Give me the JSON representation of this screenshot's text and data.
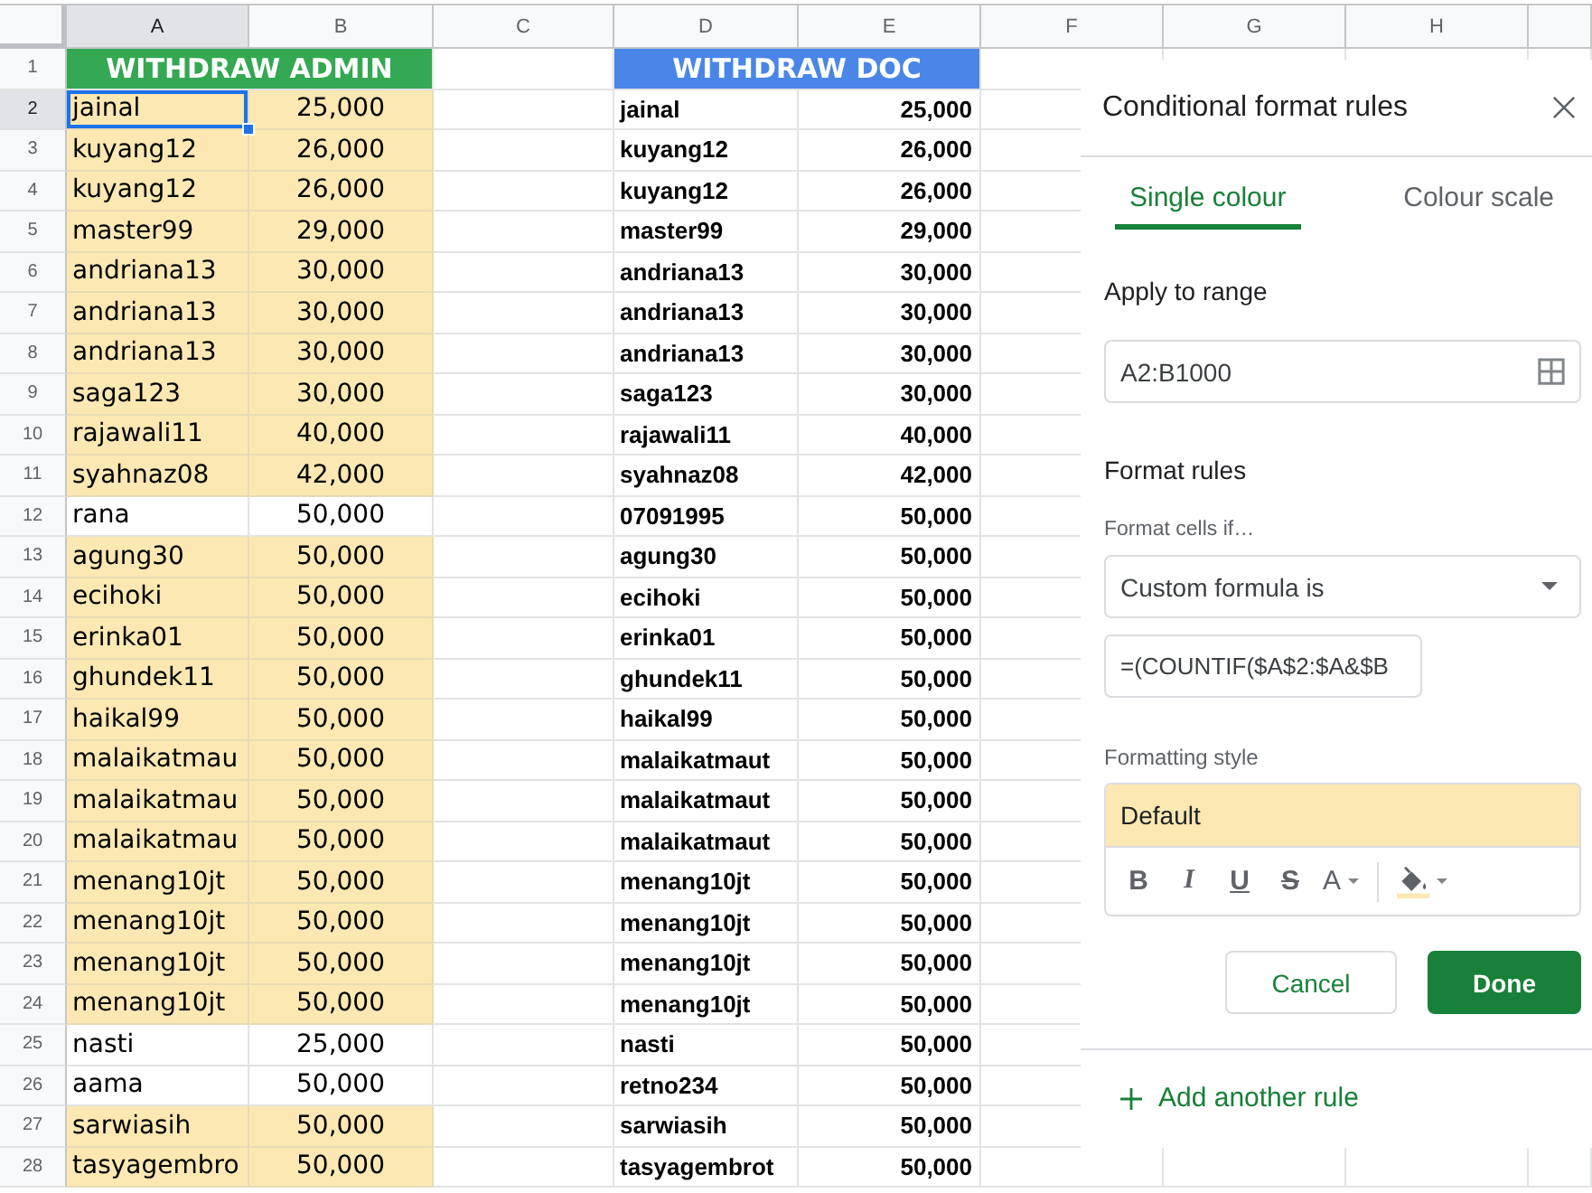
{
  "sheet": {
    "columns": [
      {
        "label": "A",
        "selected": true
      },
      {
        "label": "B",
        "selected": false
      },
      {
        "label": "C",
        "selected": false
      },
      {
        "label": "D",
        "selected": false
      },
      {
        "label": "E",
        "selected": false
      },
      {
        "label": "F",
        "selected": false
      },
      {
        "label": "G",
        "selected": false
      },
      {
        "label": "H",
        "selected": false
      }
    ],
    "row_headers": [
      {
        "label": "1",
        "selected": false
      },
      {
        "label": "2",
        "selected": true
      },
      {
        "label": "3",
        "selected": false
      },
      {
        "label": "4",
        "selected": false
      },
      {
        "label": "5",
        "selected": false
      },
      {
        "label": "6",
        "selected": false
      },
      {
        "label": "7",
        "selected": false
      },
      {
        "label": "8",
        "selected": false
      },
      {
        "label": "9",
        "selected": false
      },
      {
        "label": "10",
        "selected": false
      },
      {
        "label": "11",
        "selected": false
      },
      {
        "label": "12",
        "selected": false
      },
      {
        "label": "13",
        "selected": false
      },
      {
        "label": "14",
        "selected": false
      },
      {
        "label": "15",
        "selected": false
      },
      {
        "label": "16",
        "selected": false
      },
      {
        "label": "17",
        "selected": false
      },
      {
        "label": "18",
        "selected": false
      },
      {
        "label": "19",
        "selected": false
      },
      {
        "label": "20",
        "selected": false
      },
      {
        "label": "21",
        "selected": false
      },
      {
        "label": "22",
        "selected": false
      },
      {
        "label": "23",
        "selected": false
      },
      {
        "label": "24",
        "selected": false
      },
      {
        "label": "25",
        "selected": false
      },
      {
        "label": "26",
        "selected": false
      },
      {
        "label": "27",
        "selected": false
      },
      {
        "label": "28",
        "selected": false
      }
    ],
    "admin_table": {
      "title": "WITHDRAW ADMIN",
      "rows": [
        {
          "name": "jainal",
          "amount": "25,000",
          "highlighted": true,
          "selected": true
        },
        {
          "name": "kuyang12",
          "amount": "26,000",
          "highlighted": true,
          "selected": false
        },
        {
          "name": "kuyang12",
          "amount": "26,000",
          "highlighted": true,
          "selected": false
        },
        {
          "name": "master99",
          "amount": "29,000",
          "highlighted": true,
          "selected": false
        },
        {
          "name": "andriana13",
          "amount": "30,000",
          "highlighted": true,
          "selected": false
        },
        {
          "name": "andriana13",
          "amount": "30,000",
          "highlighted": true,
          "selected": false
        },
        {
          "name": "andriana13",
          "amount": "30,000",
          "highlighted": true,
          "selected": false
        },
        {
          "name": "saga123",
          "amount": "30,000",
          "highlighted": true,
          "selected": false
        },
        {
          "name": "rajawali11",
          "amount": "40,000",
          "highlighted": true,
          "selected": false
        },
        {
          "name": "syahnaz08",
          "amount": "42,000",
          "highlighted": true,
          "selected": false
        },
        {
          "name": "rana",
          "amount": "50,000",
          "highlighted": false,
          "selected": false
        },
        {
          "name": "agung30",
          "amount": "50,000",
          "highlighted": true,
          "selected": false
        },
        {
          "name": "ecihoki",
          "amount": "50,000",
          "highlighted": true,
          "selected": false
        },
        {
          "name": "erinka01",
          "amount": "50,000",
          "highlighted": true,
          "selected": false
        },
        {
          "name": "ghundek11",
          "amount": "50,000",
          "highlighted": true,
          "selected": false
        },
        {
          "name": "haikal99",
          "amount": "50,000",
          "highlighted": true,
          "selected": false
        },
        {
          "name": "malaikatmau",
          "amount": "50,000",
          "highlighted": true,
          "selected": false
        },
        {
          "name": "malaikatmau",
          "amount": "50,000",
          "highlighted": true,
          "selected": false
        },
        {
          "name": "malaikatmau",
          "amount": "50,000",
          "highlighted": true,
          "selected": false
        },
        {
          "name": "menang10jt",
          "amount": "50,000",
          "highlighted": true,
          "selected": false
        },
        {
          "name": "menang10jt",
          "amount": "50,000",
          "highlighted": true,
          "selected": false
        },
        {
          "name": "menang10jt",
          "amount": "50,000",
          "highlighted": true,
          "selected": false
        },
        {
          "name": "menang10jt",
          "amount": "50,000",
          "highlighted": true,
          "selected": false
        },
        {
          "name": "nasti",
          "amount": "25,000",
          "highlighted": false,
          "selected": false
        },
        {
          "name": "aama",
          "amount": "50,000",
          "highlighted": false,
          "selected": false
        },
        {
          "name": "sarwiasih",
          "amount": "50,000",
          "highlighted": true,
          "selected": false
        },
        {
          "name": "tasyagembro",
          "amount": "50,000",
          "highlighted": true,
          "selected": false
        }
      ]
    },
    "doc_table": {
      "title": "WITHDRAW DOC",
      "rows": [
        {
          "name": "jainal",
          "amount": "25,000"
        },
        {
          "name": "kuyang12",
          "amount": "26,000"
        },
        {
          "name": "kuyang12",
          "amount": "26,000"
        },
        {
          "name": "master99",
          "amount": "29,000"
        },
        {
          "name": "andriana13",
          "amount": "30,000"
        },
        {
          "name": "andriana13",
          "amount": "30,000"
        },
        {
          "name": "andriana13",
          "amount": "30,000"
        },
        {
          "name": "saga123",
          "amount": "30,000"
        },
        {
          "name": "rajawali11",
          "amount": "40,000"
        },
        {
          "name": "syahnaz08",
          "amount": "42,000"
        },
        {
          "name": "07091995",
          "amount": "50,000"
        },
        {
          "name": "agung30",
          "amount": "50,000"
        },
        {
          "name": "ecihoki",
          "amount": "50,000"
        },
        {
          "name": "erinka01",
          "amount": "50,000"
        },
        {
          "name": "ghundek11",
          "amount": "50,000"
        },
        {
          "name": "haikal99",
          "amount": "50,000"
        },
        {
          "name": "malaikatmaut",
          "amount": "50,000"
        },
        {
          "name": "malaikatmaut",
          "amount": "50,000"
        },
        {
          "name": "malaikatmaut",
          "amount": "50,000"
        },
        {
          "name": "menang10jt",
          "amount": "50,000"
        },
        {
          "name": "menang10jt",
          "amount": "50,000"
        },
        {
          "name": "menang10jt",
          "amount": "50,000"
        },
        {
          "name": "menang10jt",
          "amount": "50,000"
        },
        {
          "name": "nasti",
          "amount": "50,000"
        },
        {
          "name": "retno234",
          "amount": "50,000"
        },
        {
          "name": "sarwiasih",
          "amount": "50,000"
        },
        {
          "name": "tasyagembrot",
          "amount": "50,000"
        }
      ]
    }
  },
  "panel": {
    "title": "Conditional format rules",
    "tabs": [
      {
        "label": "Single colour",
        "selected": true
      },
      {
        "label": "Colour scale",
        "selected": false
      }
    ],
    "range_label": "Apply to range",
    "range_value": "A2:B1000",
    "rules_heading": "Format rules",
    "condition_label": "Format cells if…",
    "condition_value": "Custom formula is",
    "formula_value": "=(COUNTIF($A$2:$A&$B",
    "style_label": "Formatting style",
    "style_preview": "Default",
    "style_tools": [
      {
        "kind": "bold",
        "label": "B"
      },
      {
        "kind": "italic",
        "label": "I"
      },
      {
        "kind": "underline",
        "label": "U"
      },
      {
        "kind": "strikethrough",
        "label": "S"
      },
      {
        "kind": "text_color",
        "label": "A"
      },
      {
        "kind": "fill_color"
      }
    ],
    "buttons": [
      {
        "kind": "secondary",
        "label": "Cancel"
      },
      {
        "kind": "primary",
        "label": "Done"
      }
    ],
    "add_rule": "Add another rule"
  }
}
